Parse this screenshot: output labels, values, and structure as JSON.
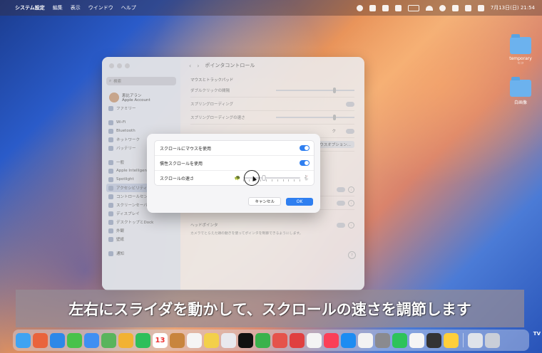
{
  "menubar": {
    "app_name": "システム設定",
    "menus": [
      "編集",
      "表示",
      "ウインドウ",
      "ヘルプ"
    ],
    "clock": "7月13日(日) 21:54"
  },
  "desktop": {
    "items": [
      {
        "name": "temporary",
        "sub": "⊂⊃"
      },
      {
        "name": "白画像",
        "sub": ""
      }
    ]
  },
  "window": {
    "title": "ポインタコントロール",
    "search_placeholder": "検索",
    "user_name": "恵比アラン",
    "user_sub": "Apple Account",
    "family": "ファミリー",
    "sidebar_items": [
      "Wi-Fi",
      "Bluetooth",
      "ネットワーク",
      "バッテリー",
      "一般",
      "Apple Intelligence",
      "Spotlight",
      "アクセシビリティ",
      "コントロールセンター",
      "スクリーンセーバ",
      "ディスプレイ",
      "デスクトップとDock",
      "外観",
      "壁紙",
      "通知"
    ],
    "selected_sidebar_index": 7,
    "section_label": "マウスとトラックパッド",
    "rows": {
      "double_click": "ダブルクリックの間隔",
      "spring_loading": "スプリングローディング",
      "spring_speed": "スプリングローディングの速さ",
      "partial_k": "ク",
      "mouse_options_button": "ウスオプション...",
      "head_pointer": "ヘッドポインタ",
      "head_pointer_desc": "カメラでとらえた頭の動きを使ってポインタを制御できるようにします。"
    },
    "help": "?"
  },
  "sheet": {
    "use_mouse_scroll": "スクロールにマウスを使用",
    "inertia_scroll": "慣性スクロールを使用",
    "scroll_speed": "スクロールの速さ",
    "scroll_speed_value": 0.36,
    "tick_count": 11,
    "cancel": "キャンセル",
    "ok": "OK"
  },
  "caption": "左右にスライダを動かして、スクロールの速さを調節します",
  "calendar_day": "13",
  "tv_badge": "TV",
  "colors": {
    "accent": "#2f7ff0"
  }
}
